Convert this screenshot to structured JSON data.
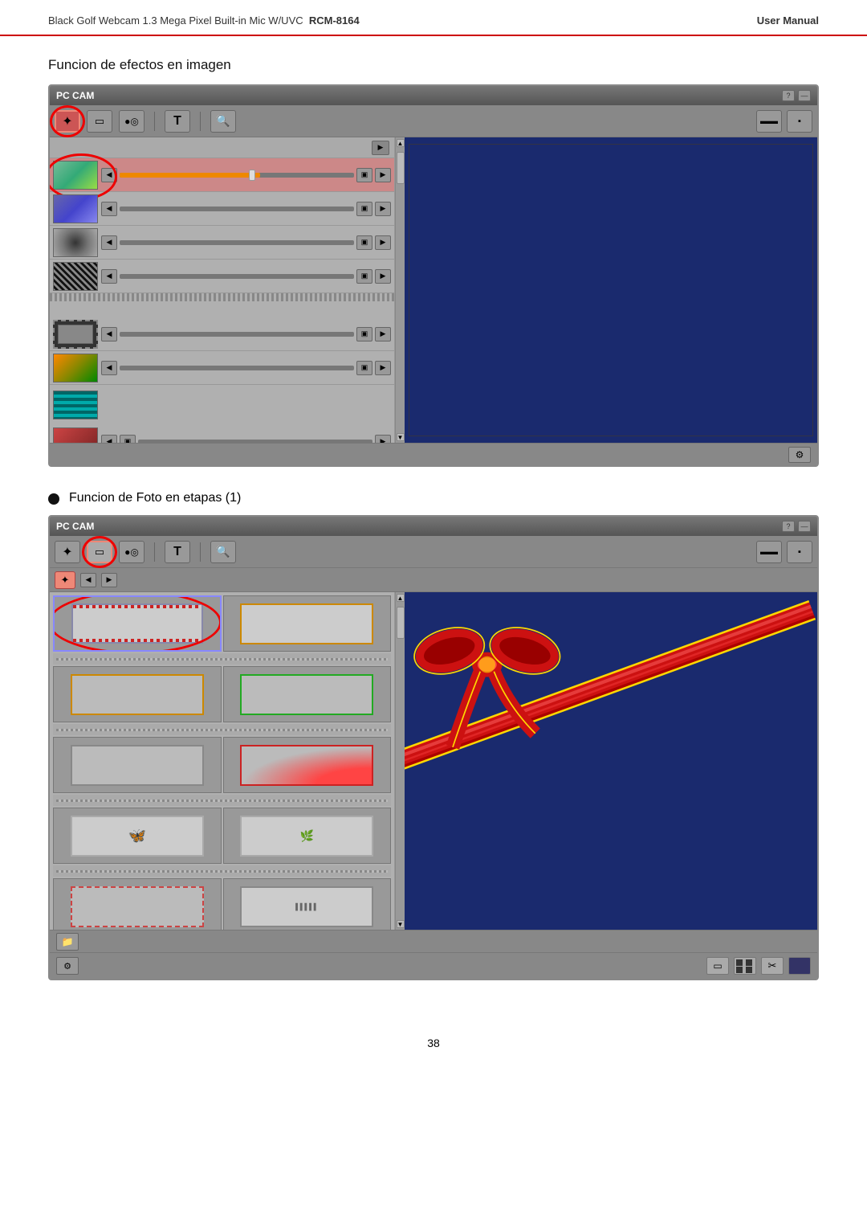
{
  "header": {
    "left_text": "Black  Golf  Webcam 1.3 Mega Pixel Built-in Mic W/UVC",
    "model": "RCM-8164",
    "right_text": "User  Manual"
  },
  "section1": {
    "title": "Funcion de efectos en imagen"
  },
  "section2": {
    "bullet_label": "Funcion de Foto en etapas (1)"
  },
  "window1": {
    "title": "PC CAM",
    "help_btn": "?",
    "min_btn": "—"
  },
  "window2": {
    "title": "PC CAM",
    "help_btn": "?",
    "min_btn": "—"
  },
  "page_number": "38"
}
